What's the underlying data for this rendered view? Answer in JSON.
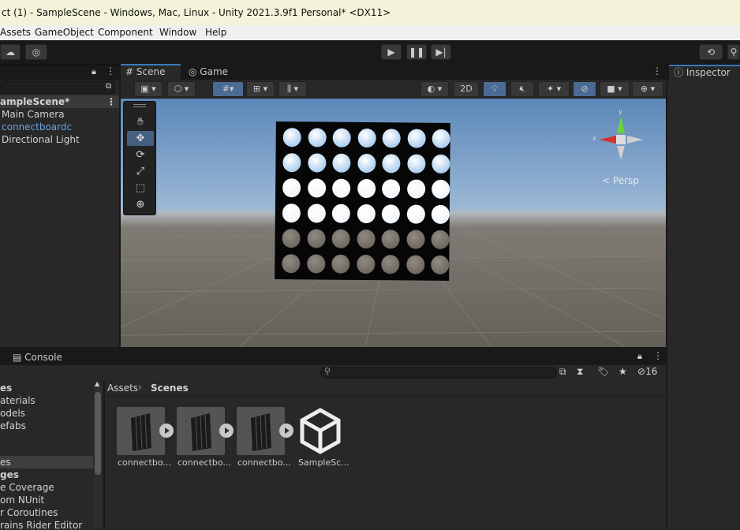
{
  "window": {
    "title": "ct (1) - SampleScene - Windows, Mac, Linux - Unity 2021.3.9f1 Personal* <DX11>"
  },
  "menu": [
    "Assets",
    "GameObject",
    "Component",
    "Window",
    "Help"
  ],
  "colors": {
    "accent": "#3a79bb",
    "selected_text": "#6aa3e0",
    "menu_bg": "#f0f0f0",
    "title_bg": "#f2f3d8"
  },
  "hierarchy": {
    "scene": "ampleScene*",
    "items": [
      "Main Camera",
      "connectboardc",
      "Directional Light"
    ]
  },
  "scene_view": {
    "tabs": [
      "Scene",
      "Game"
    ],
    "toggle_2d": "2D",
    "projection_label": "< Persp",
    "gizmo_axes": {
      "y": "y",
      "x": "x"
    }
  },
  "inspector": {
    "tab": "Inspector"
  },
  "bottom": {
    "console_tab": "Console",
    "search_placeholder": "",
    "hidden_count": "16",
    "breadcrumb": [
      "Assets",
      "Scenes"
    ],
    "tree": [
      "es",
      "aterials",
      "odels",
      "efabs",
      "es",
      "ges",
      "e Coverage",
      "om NUnit",
      "r Coroutines",
      "rains Rider Editor"
    ],
    "assets": [
      {
        "name": "connectbo...",
        "kind": "model"
      },
      {
        "name": "connectbo...",
        "kind": "model"
      },
      {
        "name": "connectbo...",
        "kind": "model"
      },
      {
        "name": "SampleSc...",
        "kind": "scene"
      }
    ]
  }
}
